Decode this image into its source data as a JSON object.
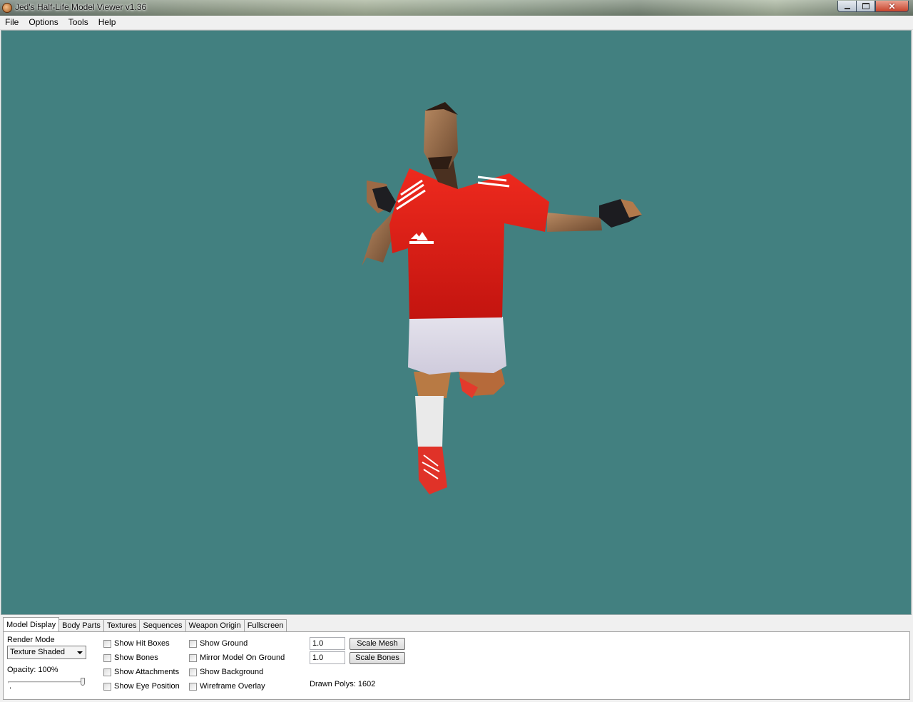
{
  "window": {
    "title": "Jed's Half-Life Model Viewer v1.36",
    "close_glyph": "✕"
  },
  "menu": [
    "File",
    "Options",
    "Tools",
    "Help"
  ],
  "viewport": {
    "background_color": "#428080"
  },
  "tabs": [
    "Model Display",
    "Body Parts",
    "Textures",
    "Sequences",
    "Weapon Origin",
    "Fullscreen"
  ],
  "active_tab": "Model Display",
  "model_display": {
    "render_mode_label": "Render Mode",
    "render_mode_value": "Texture Shaded",
    "opacity_label": "Opacity: 100%",
    "opacity_fraction": 1.0,
    "checkboxes_col1": [
      "Show Hit Boxes",
      "Show Bones",
      "Show Attachments",
      "Show Eye Position"
    ],
    "checkboxes_col2": [
      "Show Ground",
      "Mirror Model On Ground",
      "Show Background",
      "Wireframe Overlay"
    ],
    "scale_mesh_value": "1.0",
    "scale_mesh_label": "Scale Mesh",
    "scale_bones_value": "1.0",
    "scale_bones_label": "Scale Bones",
    "drawn_polys": "Drawn Polys: 1602"
  }
}
